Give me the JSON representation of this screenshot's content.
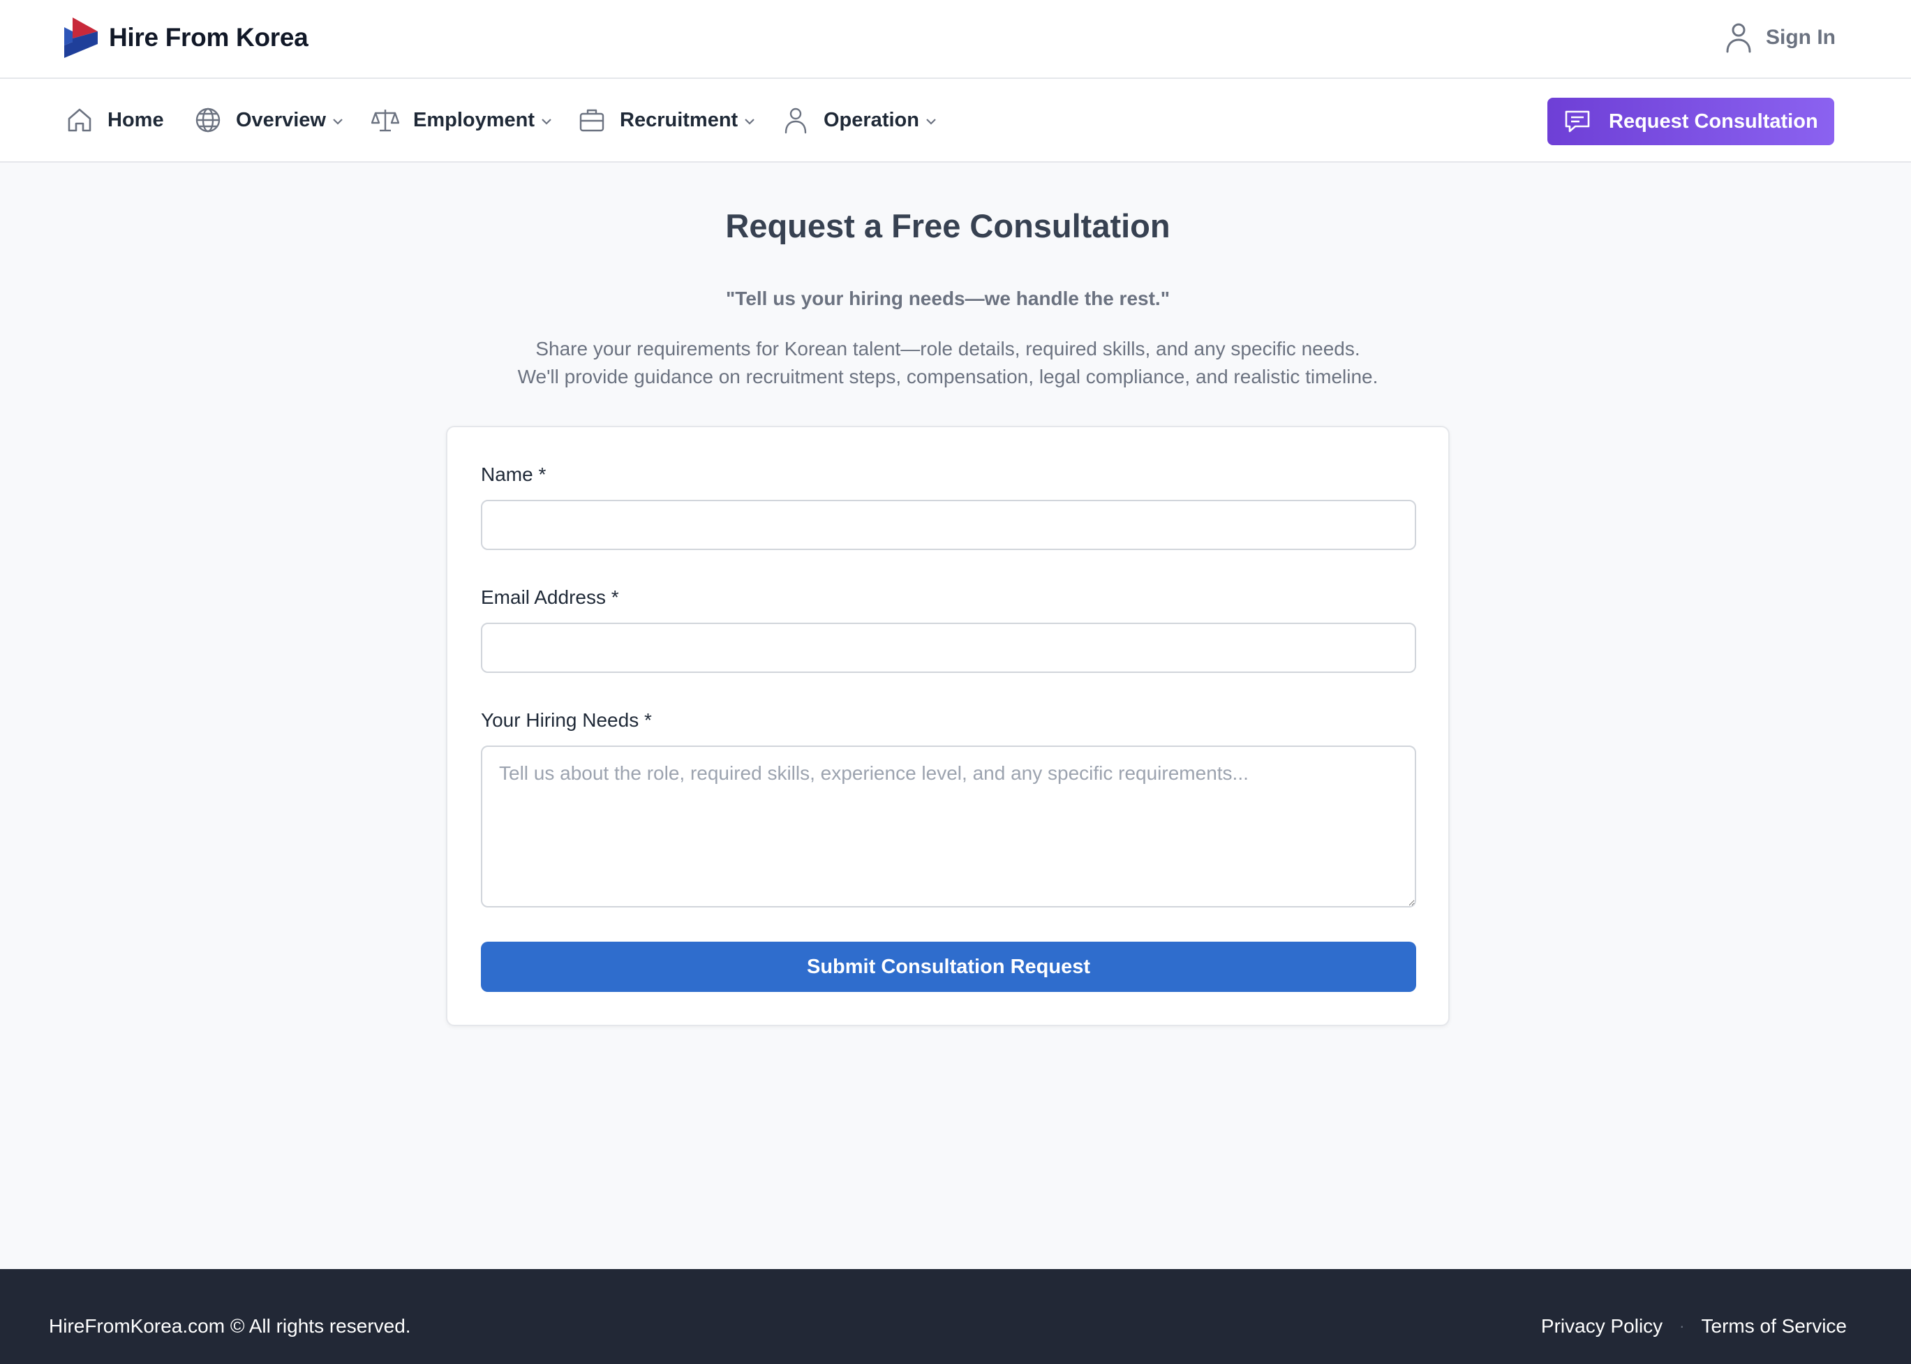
{
  "colors": {
    "cta_gradient_start": "#6e3fd6",
    "cta_gradient_end": "#8b62f0",
    "submit_blue": "#2f6dcd",
    "footer_bg": "#222836",
    "logo_red": "#c8293a",
    "logo_blue": "#1f3f9a"
  },
  "header": {
    "brand_name": "Hire From Korea",
    "logo_icon": "korea-arrow-logo",
    "signin_icon": "user-icon",
    "signin_label": "Sign In"
  },
  "nav": {
    "items": [
      {
        "label": "Home",
        "icon": "home-icon",
        "has_dropdown": false
      },
      {
        "label": "Overview",
        "icon": "globe-icon",
        "has_dropdown": true
      },
      {
        "label": "Employment",
        "icon": "scale-icon",
        "has_dropdown": true
      },
      {
        "label": "Recruitment",
        "icon": "briefcase-icon",
        "has_dropdown": true
      },
      {
        "label": "Operation",
        "icon": "person-icon",
        "has_dropdown": true
      }
    ],
    "cta_icon": "chat-icon",
    "cta_label": "Request Consultation"
  },
  "hero": {
    "title": "Request a Free Consultation",
    "tagline": "\"Tell us your hiring needs—we handle the rest.\"",
    "description_line1": "Share your requirements for Korean talent—role details, required skills, and any specific needs.",
    "description_line2": "We'll provide guidance on recruitment steps, compensation, legal compliance, and realistic timeline."
  },
  "form": {
    "name_label": "Name *",
    "name_value": "",
    "email_label": "Email Address *",
    "email_value": "",
    "needs_label": "Your Hiring Needs *",
    "needs_value": "",
    "needs_placeholder": "Tell us about the role, required skills, experience level, and any specific requirements...",
    "submit_label": "Submit Consultation Request"
  },
  "footer": {
    "copyright": "HireFromKorea.com © All rights reserved.",
    "links": [
      "Privacy Policy",
      "Terms of Service"
    ],
    "separator": "·"
  }
}
